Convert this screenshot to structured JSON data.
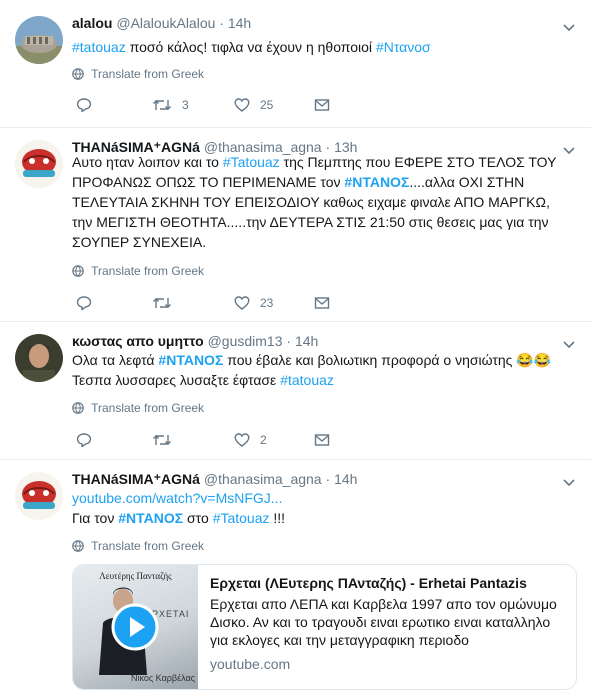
{
  "tweets": [
    {
      "name": "alalou",
      "handle": "@AlaloukAlalou",
      "dot": "·",
      "time": "14h",
      "text": [
        {
          "t": "#tatouaz",
          "type": "tag"
        },
        {
          "t": " ποσό κάλος!  τιφλα να έχουν η ηθοποιοί ",
          "type": "text"
        },
        {
          "t": "#Ντανοσ",
          "type": "tag"
        }
      ],
      "translate": "Translate from Greek",
      "replies": "",
      "retweets": "3",
      "likes": "25"
    },
    {
      "name": "THANáSIMA⁺AGNá",
      "handle": "@thanasima_agna",
      "dot": "·",
      "time": "13h",
      "text": [
        {
          "t": "Αυτο ηταν λοιπον και το ",
          "type": "text"
        },
        {
          "t": "#Tatouaz",
          "type": "tag"
        },
        {
          "t": " της Πεμπτης που ΕΦΕΡΕ ΣΤΟ ΤΕΛΟΣ ΤΟΥ ΠΡΟΦΑΝΩΣ ΟΠΩΣ ΤΟ ΠΕΡΙΜΕΝΑΜΕ τον ",
          "type": "text"
        },
        {
          "t": "#ΝΤΑΝΟΣ",
          "type": "tagb"
        },
        {
          "t": "....αλλα ΟΧΙ ΣΤΗΝ ΤΕΛΕΥΤΑΙΑ ΣΚΗΝΗ ΤΟΥ ΕΠΕΙΣΟΔΙΟΥ καθως ειχαμε φιναλε ΑΠΟ ΜΑΡΓΚΩ, την ΜΕΓΙΣΤΗ ΘΕΟΤΗΤΑ.....την ΔΕΥΤΕΡΑ ΣΤΙΣ 21:50 στις θεσεις μας για την ΣΟΥΠΕΡ ΣΥΝΕΧΕΙΑ.",
          "type": "text"
        }
      ],
      "translate": "Translate from Greek",
      "replies": "",
      "retweets": "",
      "likes": "23"
    },
    {
      "name": "κωστας απο υμηττο",
      "handle": "@gusdim13",
      "dot": "·",
      "time": "14h",
      "text": [
        {
          "t": "Ολα τα λεφτά ",
          "type": "text"
        },
        {
          "t": "#ΝΤΑΝΟΣ",
          "type": "tagb"
        },
        {
          "t": " που έβαλε και βολιωτικη προφορά ο νησιώτης 😂😂",
          "type": "text"
        },
        {
          "t": "\n",
          "type": "br"
        },
        {
          "t": "Τεσπα λυσσαρες λυσαξτε έφτασε  ",
          "type": "text"
        },
        {
          "t": "#tatouaz",
          "type": "tag"
        }
      ],
      "translate": "Translate from Greek",
      "replies": "",
      "retweets": "",
      "likes": "2"
    },
    {
      "name": "THANáSIMA⁺AGNá",
      "handle": "@thanasima_agna",
      "dot": "·",
      "time": "14h",
      "text": [
        {
          "t": "youtube.com/watch?v=MsNFGJ...",
          "type": "link"
        },
        {
          "t": "\n",
          "type": "br"
        },
        {
          "t": "Για τον ",
          "type": "text"
        },
        {
          "t": "#ΝΤΑΝΟΣ",
          "type": "tagb"
        },
        {
          "t": " στο ",
          "type": "text"
        },
        {
          "t": "#Tatouaz",
          "type": "tag"
        },
        {
          "t": " !!!",
          "type": "text"
        }
      ],
      "translate": "Translate from Greek",
      "card": {
        "thumb_top_text": "Λευτέρης Πανταζής",
        "thumb_mid_text": "ΕΡΧΕΤΑΙ",
        "thumb_bottom_text": "Νίκος Καρβέλας",
        "title": "Ερχεται (ΛΕυτερης ΠΑνταζής) - Erhetai Pantazis",
        "description": "Ερχεται απο ΛΕΠΑ και Καρβελα 1997 απο τον ομώνυμο Δισκο. Αν και το τραγουδι ειναι ερωτικο ειναι καταλληλο για εκλογες και την μεταγγραφικη περιοδο",
        "domain": "youtube.com"
      }
    }
  ],
  "colors": {
    "accent": "#1da1f2",
    "muted": "#657786",
    "text": "#14171a",
    "border": "#e6ecf0"
  }
}
